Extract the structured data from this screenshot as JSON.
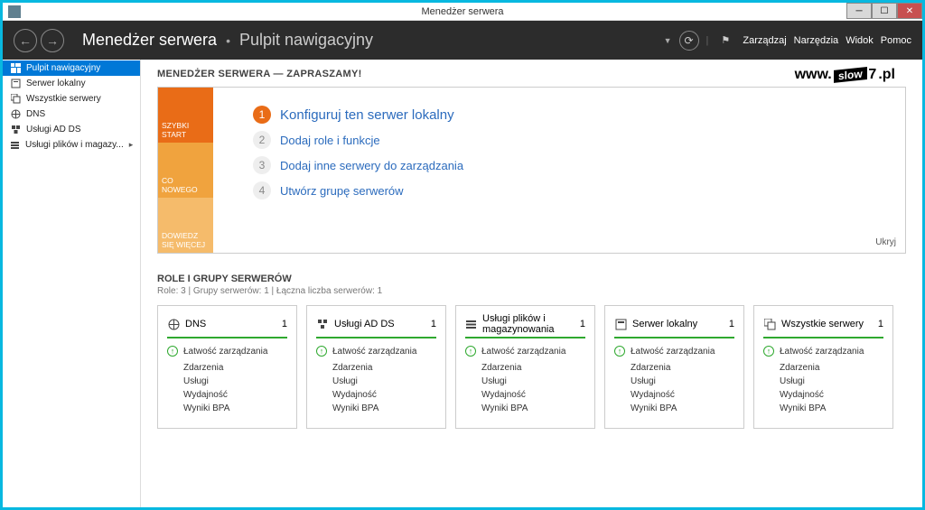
{
  "titlebar": {
    "title": "Menedżer serwera"
  },
  "header": {
    "breadcrumb_main": "Menedżer serwera",
    "breadcrumb_sub": "Pulpit nawigacyjny",
    "menu": {
      "manage": "Zarządzaj",
      "tools": "Narzędzia",
      "view": "Widok",
      "help": "Pomoc"
    }
  },
  "sidebar": {
    "items": [
      {
        "label": "Pulpit nawigacyjny",
        "icon": "dashboard",
        "active": true
      },
      {
        "label": "Serwer lokalny",
        "icon": "server"
      },
      {
        "label": "Wszystkie serwery",
        "icon": "servers"
      },
      {
        "label": "DNS",
        "icon": "dns"
      },
      {
        "label": "Usługi AD DS",
        "icon": "adds"
      },
      {
        "label": "Usługi plików i magazy...",
        "icon": "storage",
        "expandable": true
      }
    ]
  },
  "welcome": {
    "heading": "MENEDŻER SERWERA — ZAPRASZAMY!",
    "tiles": {
      "t1": "SZYBKI START",
      "t2": "CO NOWEGO",
      "t3": "DOWIEDZ SIĘ WIĘCEJ"
    },
    "steps": [
      {
        "n": "1",
        "label": "Konfiguruj ten serwer lokalny",
        "primary": true
      },
      {
        "n": "2",
        "label": "Dodaj role i funkcje"
      },
      {
        "n": "3",
        "label": "Dodaj inne serwery do zarządzania"
      },
      {
        "n": "4",
        "label": "Utwórz grupę serwerów"
      }
    ],
    "hide": "Ukryj"
  },
  "watermark": {
    "pre": "www.",
    "mid": "slow",
    "mid2": "7",
    "post": ".pl"
  },
  "roles": {
    "heading": "ROLE I GRUPY SERWERÓW",
    "sub": "Role: 3 | Grupy serwerów: 1 | Łączna liczba serwerów: 1",
    "cards": [
      {
        "title": "DNS",
        "count": "1",
        "color": "green",
        "icon": "dns"
      },
      {
        "title": "Usługi AD DS",
        "count": "1",
        "color": "green",
        "icon": "adds"
      },
      {
        "title": "Usługi plików i magazynowania",
        "count": "1",
        "color": "green",
        "icon": "storage"
      },
      {
        "title": "Serwer lokalny",
        "count": "1",
        "color": "green",
        "icon": "server"
      },
      {
        "title": "Wszystkie serwery",
        "count": "1",
        "color": "green",
        "icon": "servers"
      }
    ],
    "rows": {
      "manage": "Łatwość zarządzania",
      "events": "Zdarzenia",
      "services": "Usługi",
      "perf": "Wydajność",
      "bpa": "Wyniki BPA"
    }
  }
}
